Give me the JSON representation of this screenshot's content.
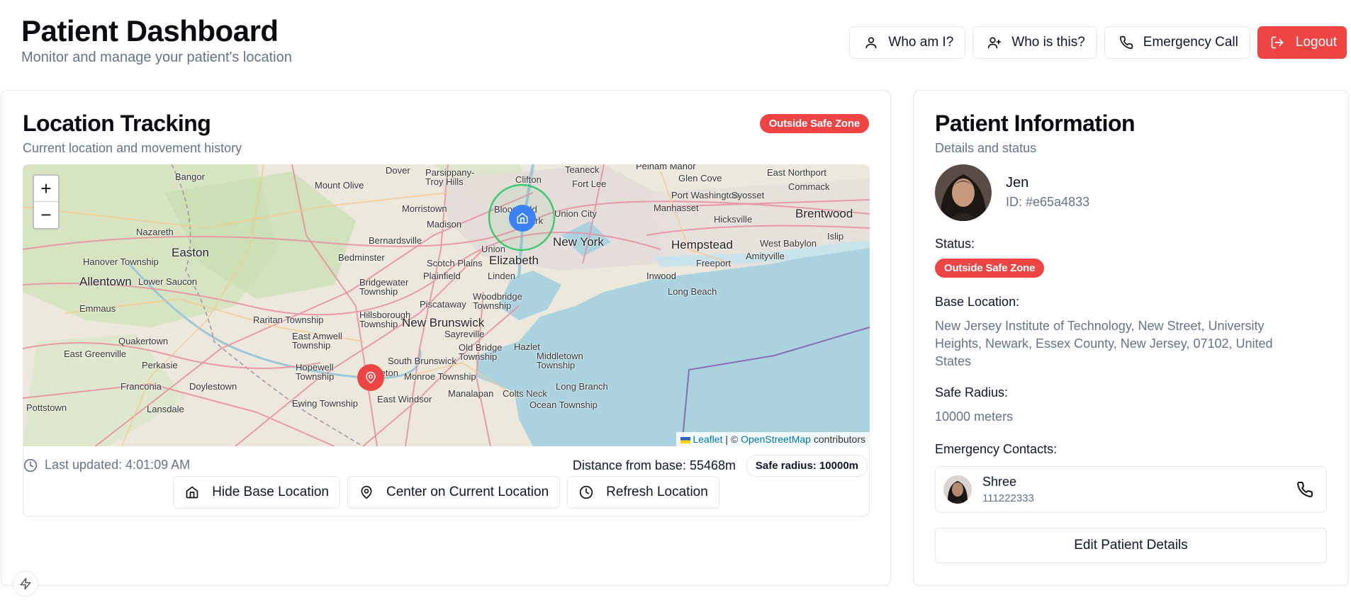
{
  "header": {
    "title": "Patient Dashboard",
    "subtitle": "Monitor and manage your patient's location"
  },
  "actions": {
    "who_am_i": "Who am I?",
    "who_is_this": "Who is this?",
    "emergency_call": "Emergency Call",
    "logout": "Logout"
  },
  "tracking": {
    "title": "Location Tracking",
    "subtitle": "Current location and movement history",
    "status_badge": "Outside Safe Zone",
    "last_updated": "Last updated: 4:01:09 AM",
    "distance": "Distance from base: 55468m",
    "safe_radius_pill": "Safe radius: 10000m",
    "hide_base_label": "Hide Base Location",
    "center_label": "Center on Current Location",
    "refresh_label": "Refresh Location"
  },
  "map": {
    "zoom_in": "+",
    "zoom_out": "−",
    "attribution_leaflet": "Leaflet",
    "attribution_sep": " | © ",
    "attribution_osm": "OpenStreetMap",
    "attribution_tail": " contributors",
    "labels": [
      "Bangor",
      "Mount Olive",
      "Dover",
      "Parsippany-Troy Hills",
      "Clifton",
      "Teaneck",
      "Fort Lee",
      "Union City",
      "Glen Cove",
      "Port Washington",
      "Manhasset",
      "Syosset",
      "East Northport",
      "Commack",
      "Brentwood",
      "Hicksville",
      "Islip",
      "Nazareth",
      "Morristown",
      "Bloomfield",
      "Madison",
      "Newark",
      "Bernardsville",
      "Easton",
      "New York",
      "Hempstead",
      "West Babylon",
      "Amityville",
      "Freeport",
      "Bedminster",
      "Union",
      "Elizabeth",
      "Scotch Plains",
      "Plainfield",
      "Linden",
      "Hanover Township",
      "Lower Saucon",
      "Allentown",
      "Bridgewater Township",
      "Inwood",
      "Long Beach",
      "Woodbridge Township",
      "Piscataway",
      "Emmaus",
      "Raritan Township",
      "Hillsborough Township",
      "New Brunswick",
      "Sayreville",
      "East Amwell Township",
      "Quakertown",
      "Old Bridge Township",
      "Hazlet",
      "Middletown Township",
      "East Greenville",
      "Perkasie",
      "Hopewell Township",
      "Princeton",
      "South Brunswick",
      "Monroe Township",
      "Franconia",
      "Doylestown",
      "Manalapan",
      "Colts Neck",
      "Long Branch",
      "Pottstown",
      "Lansdale",
      "Ewing Township",
      "East Windsor",
      "Ocean Township",
      "Pelham Manor"
    ],
    "land_color": "#ece8dc",
    "water_color": "#aad3df",
    "road_color": "#e892a2",
    "safe_zone_color": "#22c55e"
  },
  "patient": {
    "title": "Patient Information",
    "subtitle": "Details and status",
    "name": "Jen",
    "id": "ID: #e65a4833",
    "status_label": "Status:",
    "status_badge": "Outside Safe Zone",
    "base_label": "Base Location:",
    "base_value": "New Jersey Institute of Technology, New Street, University Heights, Newark, Essex County, New Jersey, 07102, United States",
    "radius_label": "Safe Radius:",
    "radius_value": "10000 meters",
    "contacts_label": "Emergency Contacts:",
    "contact_name": "Shree",
    "contact_phone": "111222333",
    "edit_label": "Edit Patient Details"
  },
  "colors": {
    "danger": "#ef4444",
    "muted_text": "#64748b",
    "border": "#e2e8f0",
    "base_marker": "#3b82f6"
  },
  "icons": [
    "user-icon",
    "user-plus-icon",
    "phone-icon",
    "logout-icon",
    "home-icon",
    "map-pin-icon",
    "clock-icon",
    "zap-icon"
  ]
}
